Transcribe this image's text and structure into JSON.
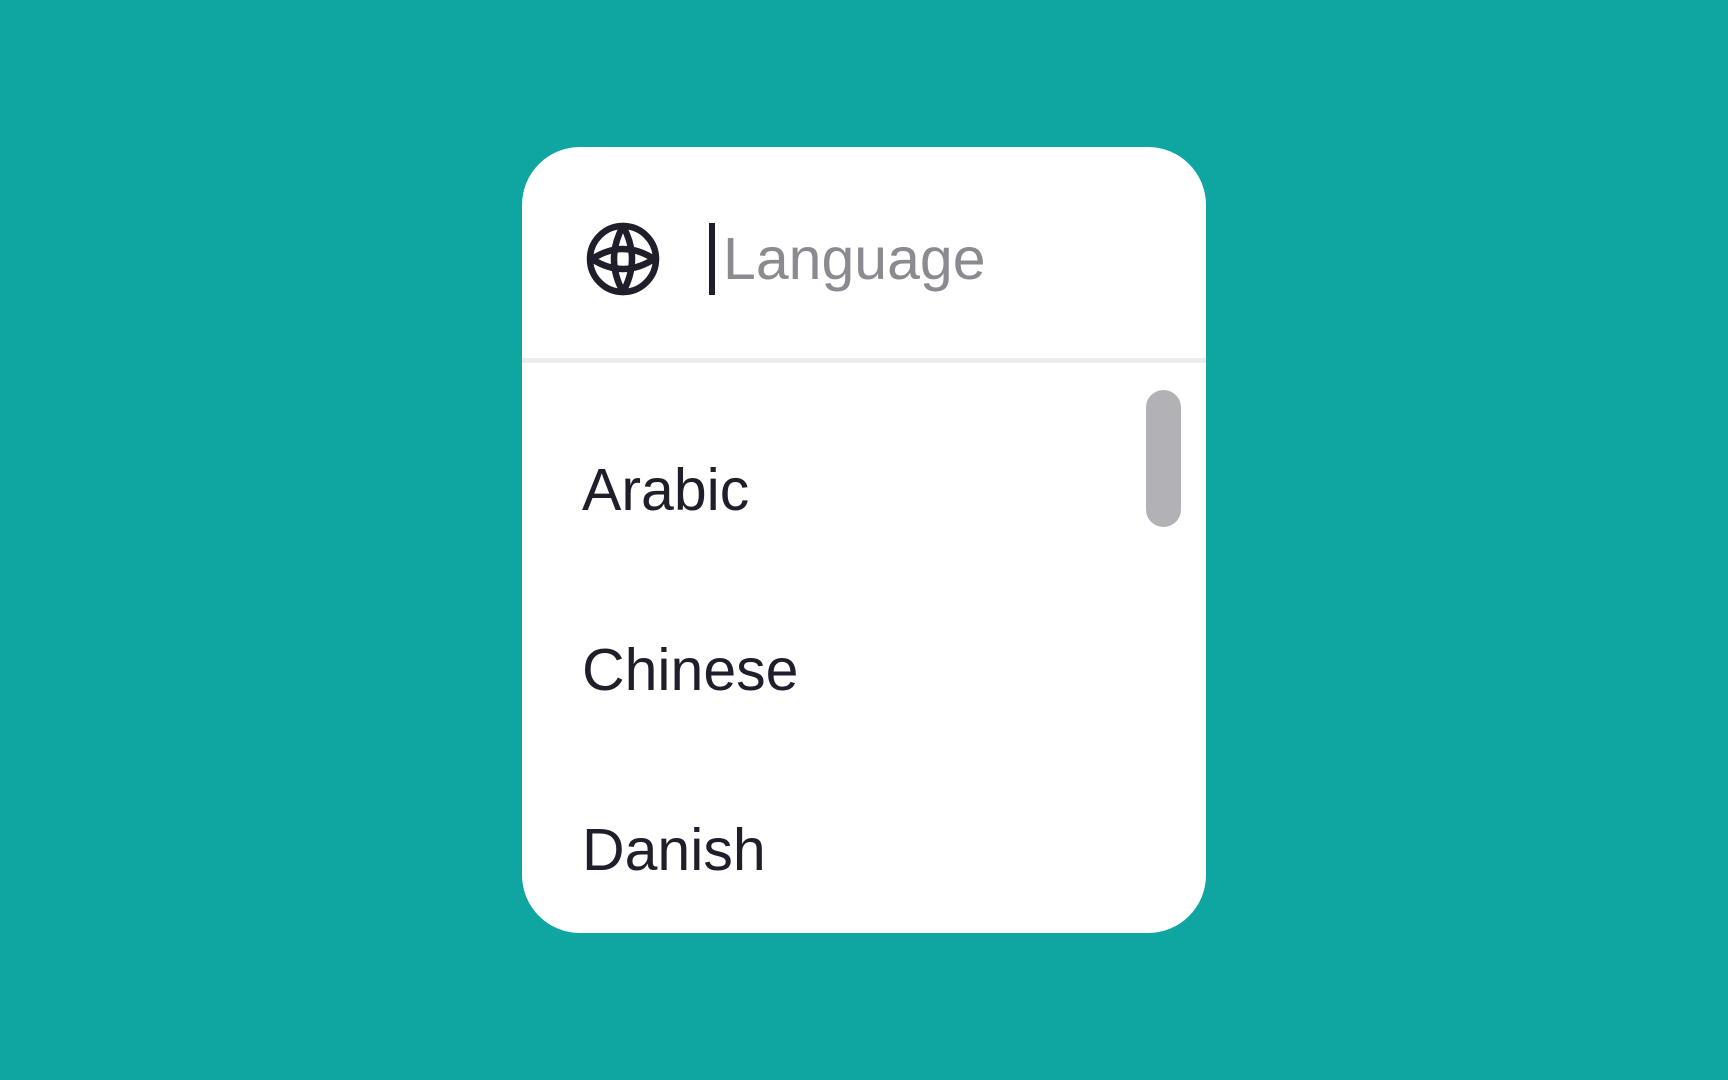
{
  "search": {
    "placeholder": "Language",
    "value": ""
  },
  "icons": {
    "search_leading": "globe-icon"
  },
  "languages": {
    "items": [
      {
        "label": "Arabic"
      },
      {
        "label": "Chinese"
      },
      {
        "label": "Danish"
      }
    ]
  },
  "scrollbar": {
    "position_fraction": 0
  },
  "colors": {
    "background": "#0fa5a0",
    "panel": "#ffffff",
    "text": "#1f1e2a",
    "placeholder": "#8b8a91",
    "divider": "#ececee",
    "scrollbar": "#b2b1b6"
  }
}
